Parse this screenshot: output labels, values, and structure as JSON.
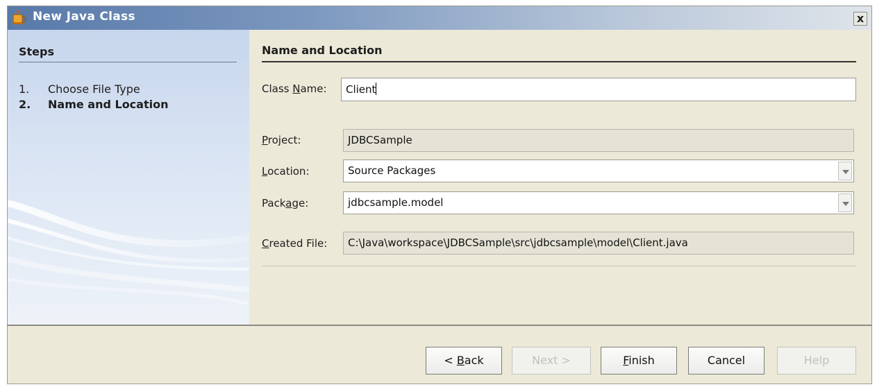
{
  "window": {
    "title": "New Java Class",
    "close_glyph": "x",
    "icon": "coffee-cup-icon"
  },
  "steps": {
    "heading": "Steps",
    "items": [
      {
        "number": "1.",
        "label": "Choose File Type",
        "current": false
      },
      {
        "number": "2.",
        "label": "Name and Location",
        "current": true
      }
    ]
  },
  "form": {
    "heading": "Name and Location",
    "class_name": {
      "label_before": "Class ",
      "label_mnemonic": "N",
      "label_after": "ame:",
      "value": "Client"
    },
    "project": {
      "label_mnemonic": "P",
      "label_after": "roject:",
      "value": "JDBCSample"
    },
    "location": {
      "label_mnemonic": "L",
      "label_after": "ocation:",
      "value": "Source Packages"
    },
    "package": {
      "label_before": "Pack",
      "label_mnemonic": "a",
      "label_after": "ge:",
      "value": "jdbcsample.model"
    },
    "created_file": {
      "label_mnemonic": "C",
      "label_after": "reated File:",
      "value": "C:\\Java\\workspace\\JDBCSample\\src\\jdbcsample\\model\\Client.java"
    }
  },
  "buttons": {
    "back": {
      "label_before": "< ",
      "mnemonic": "B",
      "label_after": "ack",
      "enabled": true
    },
    "next": {
      "label": "Next >",
      "enabled": false
    },
    "finish": {
      "mnemonic": "F",
      "label_after": "inish",
      "enabled": true
    },
    "cancel": {
      "label": "Cancel",
      "enabled": true
    },
    "help": {
      "label": "Help",
      "enabled": false
    }
  },
  "colors": {
    "title_gradient_start": "#5879a9",
    "dialog_background": "#ece9d8",
    "steps_panel": "#d8e3f3"
  }
}
